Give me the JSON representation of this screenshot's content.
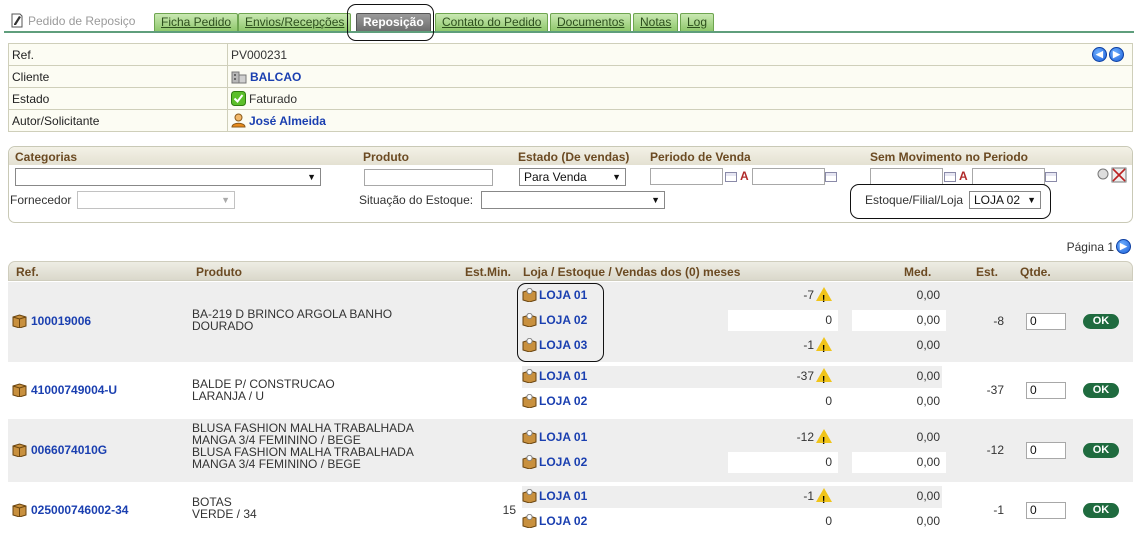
{
  "app": {
    "title": "Pedido de Reposiço"
  },
  "tabs": [
    {
      "label": "Ficha Pedido"
    },
    {
      "label": "Envios/Recepções"
    },
    {
      "label": "Reposição",
      "active": true
    },
    {
      "label": "Contato do Pedido"
    },
    {
      "label": "Documentos"
    },
    {
      "label": "Notas"
    },
    {
      "label": "Log"
    }
  ],
  "info": {
    "ref_label": "Ref.",
    "ref_value": "PV000231",
    "cliente_label": "Cliente",
    "cliente_value": "BALCAO",
    "estado_label": "Estado",
    "estado_value": "Faturado",
    "autor_label": "Autor/Solicitante",
    "autor_value": "José Almeida"
  },
  "filters": {
    "categorias_label": "Categorias",
    "produto_label": "Produto",
    "estado_label": "Estado (De vendas)",
    "estado_value": "Para Venda",
    "periodo_label": "Periodo de Venda",
    "sem_mov_label": "Sem Movimento no Periodo",
    "a_label": "A",
    "fornecedor_label": "Fornecedor",
    "situacao_label": "Situação do Estoque:",
    "estoque_label": "Estoque/Filial/Loja",
    "estoque_value": "LOJA 02"
  },
  "pagination": {
    "label": "Página 1"
  },
  "grid": {
    "headers": {
      "ref": "Ref.",
      "produto": "Produto",
      "estmin": "Est.Min.",
      "loja": "Loja / Estoque / Vendas dos (0) meses",
      "med": "Med.",
      "est": "Est.",
      "qtde": "Qtde."
    },
    "ok_label": "OK",
    "rows": [
      {
        "ref": "100019006",
        "produto": [
          "BA-219 D BRINCO ARGOLA BANHO",
          "DOURADO"
        ],
        "estmin": "",
        "stores": [
          {
            "name": "LOJA 01",
            "stock": "-7",
            "warn": true,
            "med": "0,00"
          },
          {
            "name": "LOJA 02",
            "stock": "0",
            "warn": false,
            "med": "0,00"
          },
          {
            "name": "LOJA 03",
            "stock": "-1",
            "warn": true,
            "med": "0,00"
          }
        ],
        "est": "-8",
        "qtde": "0"
      },
      {
        "ref": "41000749004-U",
        "produto": [
          "BALDE P/ CONSTRUCAO",
          "LARANJA / U"
        ],
        "estmin": "",
        "stores": [
          {
            "name": "LOJA 01",
            "stock": "-37",
            "warn": true,
            "med": "0,00"
          },
          {
            "name": "LOJA 02",
            "stock": "0",
            "warn": false,
            "med": "0,00"
          }
        ],
        "est": "-37",
        "qtde": "0"
      },
      {
        "ref": "0066074010G",
        "produto": [
          "BLUSA FASHION MALHA TRABALHADA",
          "MANGA 3/4 FEMININO / BEGE",
          "BLUSA FASHION MALHA TRABALHADA",
          "MANGA 3/4  FEMININO / BEGE"
        ],
        "estmin": "",
        "stores": [
          {
            "name": "LOJA 01",
            "stock": "-12",
            "warn": true,
            "med": "0,00"
          },
          {
            "name": "LOJA 02",
            "stock": "0",
            "warn": false,
            "med": "0,00"
          }
        ],
        "est": "-12",
        "qtde": "0"
      },
      {
        "ref": "025000746002-34",
        "produto": [
          "BOTAS",
          "VERDE / 34"
        ],
        "estmin": "15",
        "stores": [
          {
            "name": "LOJA 01",
            "stock": "-1",
            "warn": true,
            "med": "0,00"
          },
          {
            "name": "LOJA 02",
            "stock": "0",
            "warn": false,
            "med": "0,00"
          }
        ],
        "est": "-1",
        "qtde": "0"
      }
    ]
  },
  "colors": {
    "tab_green": "#8fc86c",
    "tab_active": "#6e6e6e",
    "link": "#1a3fb0",
    "header_text": "#6b4a22",
    "ok_button": "#1f6b3f"
  }
}
